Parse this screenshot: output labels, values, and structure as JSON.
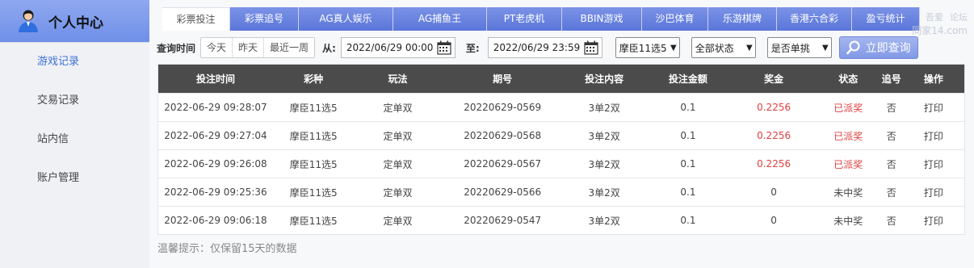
{
  "sidebar": {
    "title": "个人中心",
    "items": [
      {
        "label": "游戏记录",
        "active": true
      },
      {
        "label": "交易记录",
        "active": false
      },
      {
        "label": "站内信",
        "active": false
      },
      {
        "label": "账户管理",
        "active": false
      }
    ]
  },
  "tabs": [
    {
      "label": "彩票投注",
      "active": true
    },
    {
      "label": "彩票追号",
      "active": false
    },
    {
      "label": "AG真人娱乐",
      "active": false
    },
    {
      "label": "AG捕鱼王",
      "active": false
    },
    {
      "label": "PT老虎机",
      "active": false
    },
    {
      "label": "BBIN游戏",
      "active": false
    },
    {
      "label": "沙巴体育",
      "active": false
    },
    {
      "label": "乐游棋牌",
      "active": false
    },
    {
      "label": "香港六合彩",
      "active": false
    },
    {
      "label": "盈亏统计",
      "active": false
    }
  ],
  "watermark": {
    "line1": "吾爱",
    "line2": "论坛",
    "line3": "同家14.com"
  },
  "filter": {
    "label": "查询时间",
    "quick": [
      "今天",
      "昨天",
      "最近一周"
    ],
    "from_label": "从:",
    "from_value": "2022/06/29 00:00",
    "to_label": "至:",
    "to_value": "2022/06/29 23:59",
    "lottery_select": "摩臣11选5",
    "status_select": "全部状态",
    "single_select": "是否单挑",
    "query_button": "立即查询"
  },
  "table": {
    "headers": [
      "投注时间",
      "彩种",
      "玩法",
      "期号",
      "投注内容",
      "投注金额",
      "奖金",
      "状态",
      "追号",
      "操作"
    ],
    "rows": [
      [
        "2022-06-29 09:28:07",
        "摩臣11选5",
        "定单双",
        "20220629-0569",
        "3单2双",
        "0.1",
        "0.2256",
        "已派奖",
        "否",
        "打印"
      ],
      [
        "2022-06-29 09:27:04",
        "摩臣11选5",
        "定单双",
        "20220629-0568",
        "3单2双",
        "0.1",
        "0.2256",
        "已派奖",
        "否",
        "打印"
      ],
      [
        "2022-06-29 09:26:08",
        "摩臣11选5",
        "定单双",
        "20220629-0567",
        "3单2双",
        "0.1",
        "0.2256",
        "已派奖",
        "否",
        "打印"
      ],
      [
        "2022-06-29 09:25:36",
        "摩臣11选5",
        "定单双",
        "20220629-0566",
        "3单2双",
        "0.1",
        "0",
        "未中奖",
        "否",
        "打印"
      ],
      [
        "2022-06-29 09:06:18",
        "摩臣11选5",
        "定单双",
        "20220629-0547",
        "3单2双",
        "0.1",
        "0",
        "未中奖",
        "否",
        "打印"
      ]
    ]
  },
  "note": "温馨提示：仅保留15天的数据",
  "colors": {
    "accent": "#6f8fe8",
    "header_bg": "#4b4b4b",
    "paid": "#e04040"
  }
}
